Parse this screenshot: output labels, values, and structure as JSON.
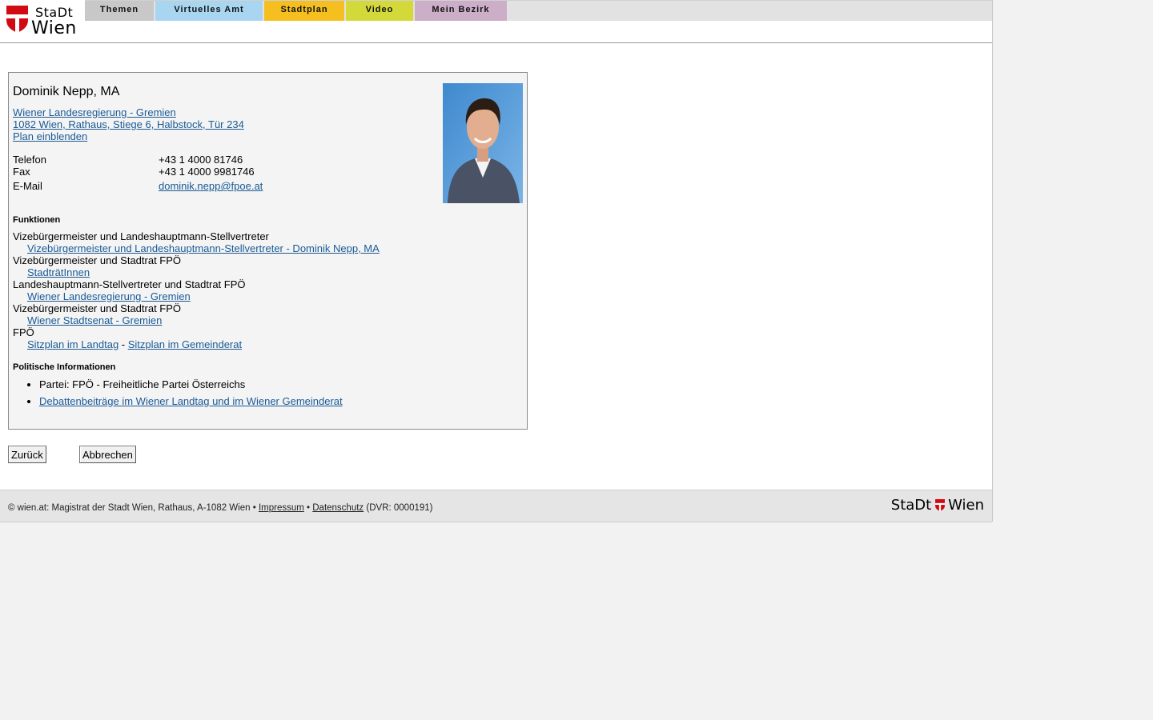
{
  "header": {
    "logo": {
      "line1": "StaDt",
      "line2": "Wien"
    },
    "nav": [
      {
        "label": "Themen",
        "color": "#c8c8c8"
      },
      {
        "label": "Virtuelles Amt",
        "color": "#a8d6f0"
      },
      {
        "label": "Stadtplan",
        "color": "#f5c01f"
      },
      {
        "label": "Video",
        "color": "#d4d93a"
      },
      {
        "label": "Mein Bezirk",
        "color": "#ccaec8"
      }
    ]
  },
  "person": {
    "name": "Dominik Nepp, MA",
    "org_link": "Wiener Landesregierung - Gremien",
    "address_link": "1082 Wien, Rathaus, Stiege 6, Halbstock, Tür 234",
    "plan_link": "Plan einblenden",
    "contacts": [
      {
        "label": "Telefon",
        "value": "+43 1 4000 81746"
      },
      {
        "label": "Fax",
        "value": "+43 1 4000 9981746"
      }
    ],
    "email_label": "E-Mail",
    "email": "dominik.nepp@fpoe.at"
  },
  "funktionen": {
    "heading": "Funktionen",
    "items": [
      {
        "title": "Vizebürgermeister und Landeshauptmann-Stellvertreter",
        "links": [
          "Vizebürgermeister und Landeshauptmann-Stellvertreter - Dominik Nepp, MA"
        ]
      },
      {
        "title": "Vizebürgermeister und Stadtrat FPÖ",
        "links": [
          "StadträtInnen"
        ]
      },
      {
        "title": "Landeshauptmann-Stellvertreter und Stadtrat FPÖ",
        "links": [
          "Wiener Landesregierung - Gremien"
        ]
      },
      {
        "title": "Vizebürgermeister und Stadtrat FPÖ",
        "links": [
          "Wiener Stadtsenat - Gremien"
        ]
      },
      {
        "title": "FPÖ",
        "links": [
          "Sitzplan im Landtag",
          "Sitzplan im Gemeinderat"
        ],
        "separator": " - "
      }
    ]
  },
  "politik": {
    "heading": "Politische Informationen",
    "partei": "Partei: FPÖ - Freiheitliche Partei Österreichs",
    "debatten_link": "Debattenbeiträge im Wiener Landtag und im Wiener Gemeinderat"
  },
  "buttons": {
    "back": "Zurück",
    "cancel": "Abbrechen"
  },
  "footer": {
    "prefix": "© wien.at: Magistrat der Stadt Wien, Rathaus, A-1082 Wien •",
    "impressum": "Impressum",
    "bullet": "•",
    "datenschutz": "Datenschutz",
    "dvr": "(DVR: 0000191)",
    "logo_left": "StaDt",
    "logo_right": "Wien"
  },
  "colors": {
    "link": "#1a5a96",
    "wien_red": "#d20a11"
  }
}
